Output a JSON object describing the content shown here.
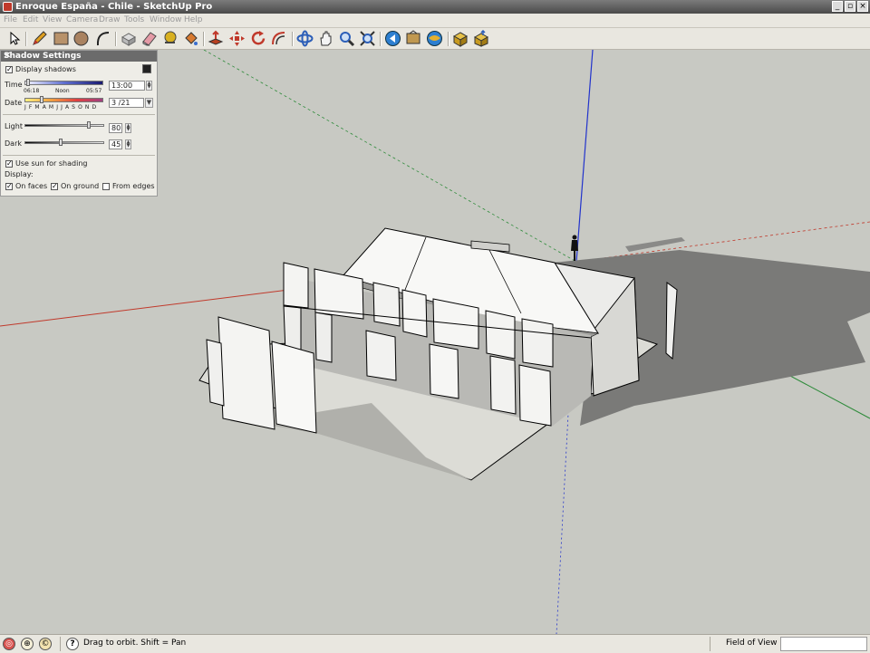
{
  "window": {
    "title": "Enroque España - Chile - SketchUp Pro"
  },
  "menu": [
    "File",
    "Edit",
    "View",
    "Camera",
    "Draw",
    "Tools",
    "Window",
    "Help"
  ],
  "toolbar": {
    "tools": [
      "select-icon",
      "pencil-icon",
      "rectangle-icon",
      "circle-icon",
      "arc-icon",
      "make-component-icon",
      "eraser-icon",
      "tape-measure-icon",
      "paint-bucket-icon",
      "push-pull-icon",
      "move-icon",
      "rotate-icon",
      "offset-icon",
      "orbit-icon",
      "pan-icon",
      "zoom-icon",
      "zoom-extents-icon",
      "previous-view-icon",
      "next-view-icon",
      "position-camera-icon",
      "get-models-icon",
      "share-model-icon"
    ]
  },
  "shadow_panel": {
    "title": "Shadow Settings",
    "display_shadows_label": "Display shadows",
    "display_shadows_checked": true,
    "time_label": "Time",
    "time_start": "06:18",
    "time_noon": "Noon",
    "time_end": "05:57",
    "time_value": "13:00",
    "date_label": "Date",
    "months": "J F M A M J J A S O N D",
    "date_value": "3 /21",
    "light_label": "Light",
    "light_value": "80",
    "dark_label": "Dark",
    "dark_value": "45",
    "use_sun_label": "Use sun for shading",
    "use_sun_checked": true,
    "display_label": "Display:",
    "on_faces_label": "On faces",
    "on_faces_checked": true,
    "on_ground_label": "On ground",
    "on_ground_checked": true,
    "from_edges_label": "From edges",
    "from_edges_checked": false
  },
  "status": {
    "hint": "Drag to orbit.  Shift = Pan",
    "fov_label": "Field of View",
    "fov_value": ""
  },
  "colors": {
    "viewport_bg": "#c8c9c3",
    "axis_red": "#c0392b",
    "axis_green": "#2e8b3a",
    "axis_blue": "#2233cc",
    "shadow": "#7a7a78"
  }
}
